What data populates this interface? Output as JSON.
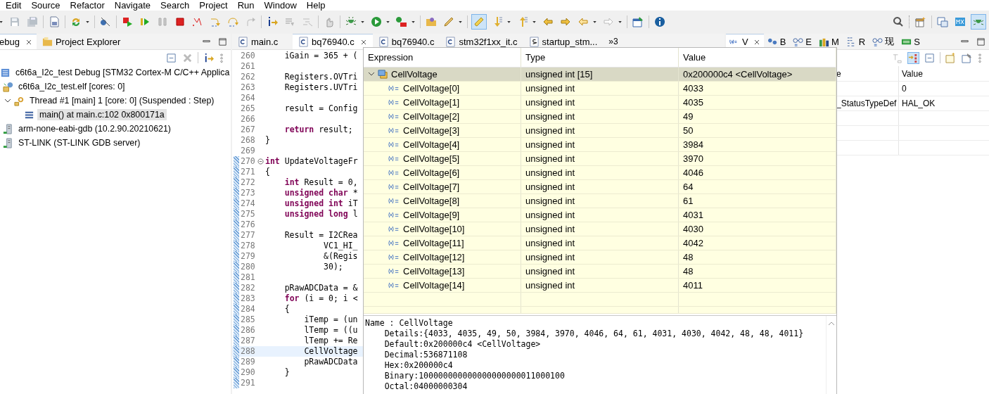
{
  "menu": [
    "Edit",
    "Source",
    "Refactor",
    "Navigate",
    "Search",
    "Project",
    "Run",
    "Window",
    "Help"
  ],
  "toolbar": {
    "pen_toggle": {
      "on": true
    },
    "perspectives": [
      {
        "selected": false
      },
      {
        "selected": false
      },
      {
        "selected": true
      }
    ]
  },
  "debug_view": {
    "tabs": [
      {
        "label": "ebug",
        "selected": true
      },
      {
        "label": "Project Explorer",
        "selected": false
      }
    ],
    "tree": [
      {
        "label": "c6t6a_I2c_test Debug [STM32 Cortex-M C/C++ Applica",
        "kind": "launch",
        "selected": false,
        "children": [
          {
            "label": "c6t6a_I2c_test.elf [cores: 0]",
            "kind": "process",
            "selected": false,
            "children": [
              {
                "label": "Thread #1 [main] 1 [core: 0] (Suspended : Step)",
                "kind": "thread",
                "expanded": true,
                "selected": false,
                "children": [
                  {
                    "label": "main() at main.c:102 0x800171a",
                    "kind": "frame",
                    "selected": true
                  }
                ]
              }
            ]
          },
          {
            "label": "arm-none-eabi-gdb (10.2.90.20210621)",
            "kind": "gdb",
            "selected": false
          },
          {
            "label": "ST-LINK (ST-LINK GDB server)",
            "kind": "gdb",
            "selected": false
          }
        ]
      }
    ]
  },
  "editor": {
    "tabs": [
      {
        "label": "main.c",
        "kind": "c",
        "selected": false
      },
      {
        "label": "bq76940.c",
        "kind": "c",
        "selected": true
      },
      {
        "label": "bq76940.c",
        "kind": "c",
        "selected": false
      },
      {
        "label": "stm32f1xx_it.c",
        "kind": "c",
        "selected": false
      },
      {
        "label": "startup_stm...",
        "kind": "asm",
        "selected": false
      }
    ],
    "overflow": "»3",
    "lines": [
      {
        "number": "260",
        "code": "    iGain = 365 + (",
        "current": false,
        "range": false
      },
      {
        "number": "261",
        "current": false,
        "range": false
      },
      {
        "number": "262",
        "code": "    Registers.OVTri",
        "current": false,
        "range": false
      },
      {
        "number": "263",
        "code": "    Registers.UVTri",
        "current": false,
        "range": false
      },
      {
        "number": "264",
        "current": false,
        "range": false
      },
      {
        "number": "265",
        "code": "    result = Config",
        "current": false,
        "range": false
      },
      {
        "number": "266",
        "current": false,
        "range": false
      },
      {
        "number": "267",
        "code": "    **return** result;",
        "current": false,
        "range": false
      },
      {
        "number": "268",
        "code": "}",
        "current": false,
        "range": false
      },
      {
        "number": "269",
        "current": false,
        "range": false
      },
      {
        "number": "270",
        "code": "**int** UpdateVoltageFr",
        "current": false,
        "range": true,
        "foldable": true
      },
      {
        "number": "271",
        "code": "{",
        "current": false,
        "range": true
      },
      {
        "number": "272",
        "code": "    **int** Result = 0,",
        "current": false,
        "range": true
      },
      {
        "number": "273",
        "code": "    **unsigned char** *",
        "current": false,
        "range": true
      },
      {
        "number": "274",
        "code": "    **unsigned int** iT",
        "current": false,
        "range": true
      },
      {
        "number": "275",
        "code": "    **unsigned long** l",
        "current": false,
        "range": true
      },
      {
        "number": "276",
        "current": false,
        "range": true
      },
      {
        "number": "277",
        "code": "    Result = I2CRea",
        "current": false,
        "range": true
      },
      {
        "number": "278",
        "code": "            VC1_HI_",
        "current": false,
        "range": true
      },
      {
        "number": "279",
        "code": "            &(Regis",
        "current": false,
        "range": true
      },
      {
        "number": "280",
        "code": "            30);",
        "current": false,
        "range": true
      },
      {
        "number": "281",
        "current": false,
        "range": true
      },
      {
        "number": "282",
        "code": "    pRawADCData = &",
        "current": false,
        "range": true
      },
      {
        "number": "283",
        "code": "    **for** (i = 0; i <",
        "current": false,
        "range": true
      },
      {
        "number": "284",
        "code": "    {",
        "current": false,
        "range": true
      },
      {
        "number": "285",
        "code": "        iTemp = (un",
        "current": false,
        "range": true
      },
      {
        "number": "286",
        "code": "        lTemp = ((u",
        "current": false,
        "range": true
      },
      {
        "number": "287",
        "code": "        lTemp += Re",
        "current": false,
        "range": true
      },
      {
        "number": "288",
        "code": "        CellVoltage",
        "current": true,
        "range": true
      },
      {
        "number": "289",
        "code": "        pRawADCData",
        "current": false,
        "range": true
      },
      {
        "number": "290",
        "code": "    }",
        "current": false,
        "range": true
      },
      {
        "number": "291",
        "current": false,
        "range": true
      }
    ]
  },
  "variables_view": {
    "tabs": [
      {
        "label": "V",
        "kind": "variables",
        "selected": true
      },
      {
        "label": "B",
        "kind": "breakpoints",
        "selected": false
      },
      {
        "label": "E",
        "kind": "expressions",
        "selected": false
      },
      {
        "label": "M",
        "kind": "modules",
        "selected": false
      },
      {
        "label": "R",
        "kind": "registers",
        "selected": false
      },
      {
        "label": "现",
        "kind": "expressions",
        "selected": false
      },
      {
        "label": "S",
        "kind": "sfr",
        "selected": false
      }
    ],
    "toolbar_toggle": {
      "on": true
    },
    "columns": [
      "e",
      "Value"
    ],
    "rows": [
      {
        "value": "0"
      },
      {
        "type": "_StatusTypeDef",
        "value": "HAL_OK"
      }
    ]
  },
  "hover_popup": {
    "columns": [
      "Expression",
      "Type",
      "Value"
    ],
    "variable": {
      "expression": "CellVoltage",
      "type": "unsigned int [15]",
      "value": "0x200000c4 <CellVoltage>",
      "expanded": true,
      "selected": true
    },
    "elements": [
      {
        "expression": "CellVoltage[0]",
        "type": "unsigned int",
        "value": "4033",
        "selected": false
      },
      {
        "expression": "CellVoltage[1]",
        "type": "unsigned int",
        "value": "4035",
        "selected": false
      },
      {
        "expression": "CellVoltage[2]",
        "type": "unsigned int",
        "value": "49",
        "selected": false
      },
      {
        "expression": "CellVoltage[3]",
        "type": "unsigned int",
        "value": "50",
        "selected": false
      },
      {
        "expression": "CellVoltage[4]",
        "type": "unsigned int",
        "value": "3984",
        "selected": false
      },
      {
        "expression": "CellVoltage[5]",
        "type": "unsigned int",
        "value": "3970",
        "selected": false
      },
      {
        "expression": "CellVoltage[6]",
        "type": "unsigned int",
        "value": "4046",
        "selected": false
      },
      {
        "expression": "CellVoltage[7]",
        "type": "unsigned int",
        "value": "64",
        "selected": false
      },
      {
        "expression": "CellVoltage[8]",
        "type": "unsigned int",
        "value": "61",
        "selected": false
      },
      {
        "expression": "CellVoltage[9]",
        "type": "unsigned int",
        "value": "4031",
        "selected": false
      },
      {
        "expression": "CellVoltage[10]",
        "type": "unsigned int",
        "value": "4030",
        "selected": false
      },
      {
        "expression": "CellVoltage[11]",
        "type": "unsigned int",
        "value": "4042",
        "selected": false
      },
      {
        "expression": "CellVoltage[12]",
        "type": "unsigned int",
        "value": "48",
        "selected": false
      },
      {
        "expression": "CellVoltage[13]",
        "type": "unsigned int",
        "value": "48",
        "selected": false
      },
      {
        "expression": "CellVoltage[14]",
        "type": "unsigned int",
        "value": "4011",
        "selected": false
      }
    ],
    "details": [
      "Name : CellVoltage",
      "    Details:{4033, 4035, 49, 50, 3984, 3970, 4046, 64, 61, 4031, 4030, 4042, 48, 48, 4011}",
      "    Default:0x200000c4 <CellVoltage>",
      "    Decimal:536871108",
      "    Hex:0x200000c4",
      "    Binary:100000000000000000000011000100",
      "    Octal:04000000304"
    ]
  }
}
